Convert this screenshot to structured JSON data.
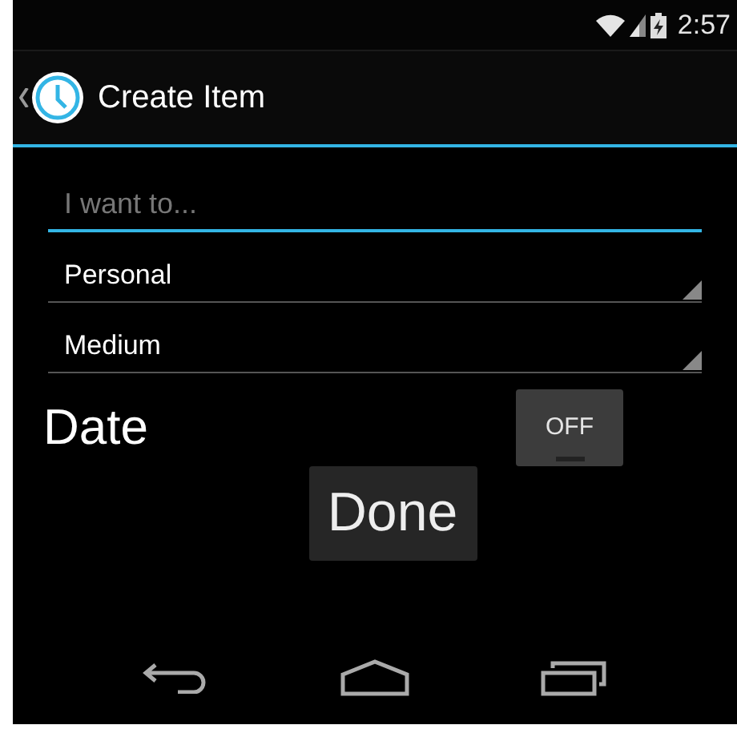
{
  "status_bar": {
    "time": "2:57"
  },
  "action_bar": {
    "title": "Create Item"
  },
  "task_field": {
    "placeholder": "I want to..."
  },
  "spinners": [
    {
      "value": "Personal"
    },
    {
      "value": "Medium"
    }
  ],
  "date_row": {
    "label": "Date",
    "toggle": {
      "on": false,
      "label": "OFF"
    }
  },
  "done_button": {
    "label": "Done"
  }
}
